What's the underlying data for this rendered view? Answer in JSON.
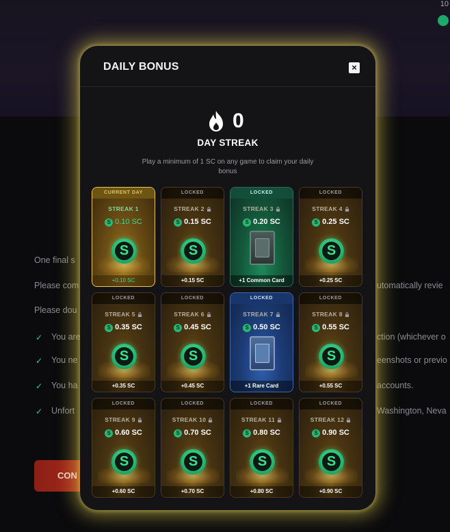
{
  "background": {
    "topright_text": "10",
    "lines": [
      {
        "left": "One final s",
        "right": ""
      },
      {
        "left": "Please com",
        "right": "utomatically revie"
      },
      {
        "left": "Please dou",
        "right": ""
      }
    ],
    "checklist": [
      {
        "left": "You are",
        "right": "ction (whichever o"
      },
      {
        "left": "You ne",
        "right": "eenshots or previo"
      },
      {
        "left": "You ha",
        "right": "accounts."
      },
      {
        "left": "Unfort",
        "right": "Washington, Neva"
      }
    ],
    "button_label": "CON"
  },
  "modal": {
    "title": "DAILY BONUS",
    "close_label": "×",
    "streak_count": "0",
    "streak_label": "DAY STREAK",
    "description": "Play a minimum of 1 SC on any game to claim your daily bonus"
  },
  "cards": [
    {
      "badge": "CURRENT DAY",
      "name": "STREAK 1",
      "amount": "0.10 SC",
      "reward": "+0.10 SC",
      "kind": "coin",
      "state": "current"
    },
    {
      "badge": "LOCKED",
      "name": "STREAK 2",
      "amount": "0.15 SC",
      "reward": "+0.15 SC",
      "kind": "coin",
      "state": "locked"
    },
    {
      "badge": "LOCKED",
      "name": "STREAK 3",
      "amount": "0.20 SC",
      "reward": "+1 Common Card",
      "kind": "common",
      "state": "locked"
    },
    {
      "badge": "LOCKED",
      "name": "STREAK 4",
      "amount": "0.25 SC",
      "reward": "+0.25 SC",
      "kind": "coin",
      "state": "locked"
    },
    {
      "badge": "LOCKED",
      "name": "STREAK 5",
      "amount": "0.35 SC",
      "reward": "+0.35 SC",
      "kind": "coin",
      "state": "locked"
    },
    {
      "badge": "LOCKED",
      "name": "STREAK 6",
      "amount": "0.45 SC",
      "reward": "+0.45 SC",
      "kind": "coin",
      "state": "locked"
    },
    {
      "badge": "LOCKED",
      "name": "STREAK 7",
      "amount": "0.50 SC",
      "reward": "+1 Rare Card",
      "kind": "rare",
      "state": "locked"
    },
    {
      "badge": "LOCKED",
      "name": "STREAK 8",
      "amount": "0.55 SC",
      "reward": "+0.55 SC",
      "kind": "coin",
      "state": "locked"
    },
    {
      "badge": "LOCKED",
      "name": "STREAK 9",
      "amount": "0.60 SC",
      "reward": "+0.60 SC",
      "kind": "coin",
      "state": "locked"
    },
    {
      "badge": "LOCKED",
      "name": "STREAK 10",
      "amount": "0.70 SC",
      "reward": "+0.70 SC",
      "kind": "coin",
      "state": "locked"
    },
    {
      "badge": "LOCKED",
      "name": "STREAK 11",
      "amount": "0.80 SC",
      "reward": "+0.80 SC",
      "kind": "coin",
      "state": "locked"
    },
    {
      "badge": "LOCKED",
      "name": "STREAK 12",
      "amount": "0.90 SC",
      "reward": "+0.90 SC",
      "kind": "coin",
      "state": "locked"
    }
  ],
  "icons": {
    "coin_glyph": "S"
  },
  "colors": {
    "accent_glow": "#ddc848",
    "coin_green": "#29b873",
    "common_green": "#1d8a58",
    "rare_blue": "#2f5fae"
  }
}
